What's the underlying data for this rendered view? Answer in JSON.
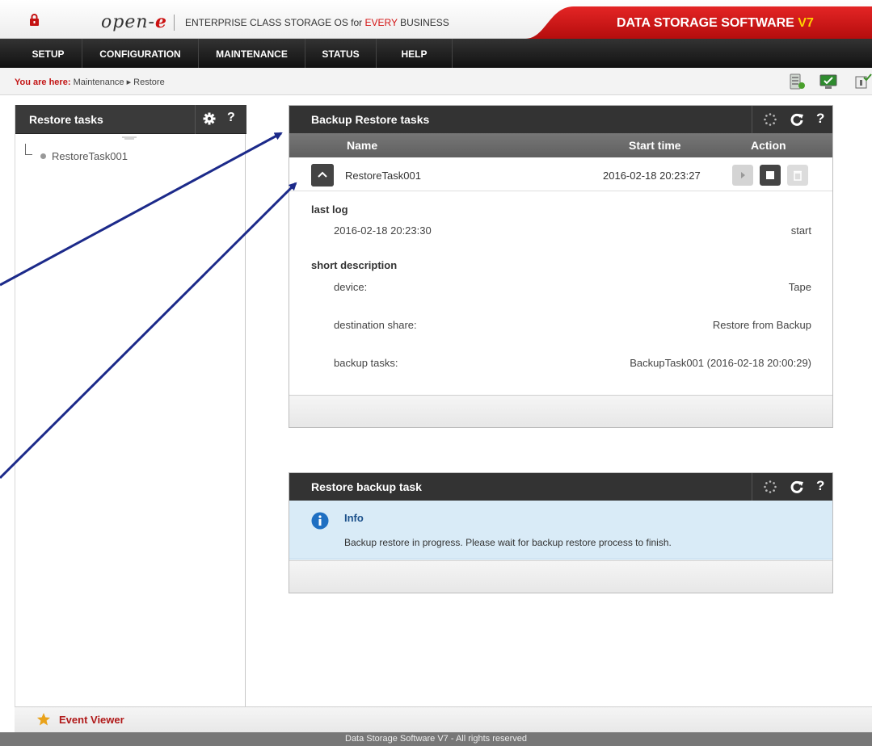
{
  "header": {
    "logo_text": "open-",
    "logo_e": "e",
    "tagline_pre": "ENTERPRISE CLASS STORAGE OS for ",
    "tagline_red": "EVERY",
    "tagline_post": " BUSINESS",
    "brand_text": "DATA STORAGE SOFTWARE ",
    "brand_version": "V7",
    "accent_color": "#d31212"
  },
  "nav": {
    "items": [
      {
        "label": "SETUP"
      },
      {
        "label": "CONFIGURATION"
      },
      {
        "label": "MAINTENANCE"
      },
      {
        "label": "STATUS"
      },
      {
        "label": "HELP"
      }
    ]
  },
  "breadcrumb": {
    "prefix": "You are here:",
    "path": "Maintenance ▸ Restore"
  },
  "left_panel": {
    "title": "Restore tasks",
    "help": "?",
    "tree": [
      {
        "label": "RestoreTask001"
      }
    ]
  },
  "backup_panel": {
    "title": "Backup Restore tasks",
    "help": "?",
    "columns": {
      "name": "Name",
      "start_time": "Start time",
      "action": "Action"
    },
    "task": {
      "name": "RestoreTask001",
      "start_time": "2016-02-18 20:23:27"
    },
    "last_log_label": "last log",
    "last_log_time": "2016-02-18 20:23:30",
    "last_log_value": "start",
    "short_description_label": "short description",
    "details": [
      {
        "label": "device:",
        "value": "Tape"
      },
      {
        "label": "destination share:",
        "value": "Restore from Backup"
      },
      {
        "label": "backup tasks:",
        "value": "BackupTask001 (2016-02-18 20:00:29)"
      }
    ]
  },
  "restore_panel": {
    "title": "Restore backup task",
    "help": "?",
    "info_title": "Info",
    "info_text": "Backup restore in progress. Please wait for backup restore process to finish."
  },
  "event_viewer": {
    "label": "Event Viewer"
  },
  "footer": {
    "text": "Data Storage Software V7 - All rights reserved"
  }
}
